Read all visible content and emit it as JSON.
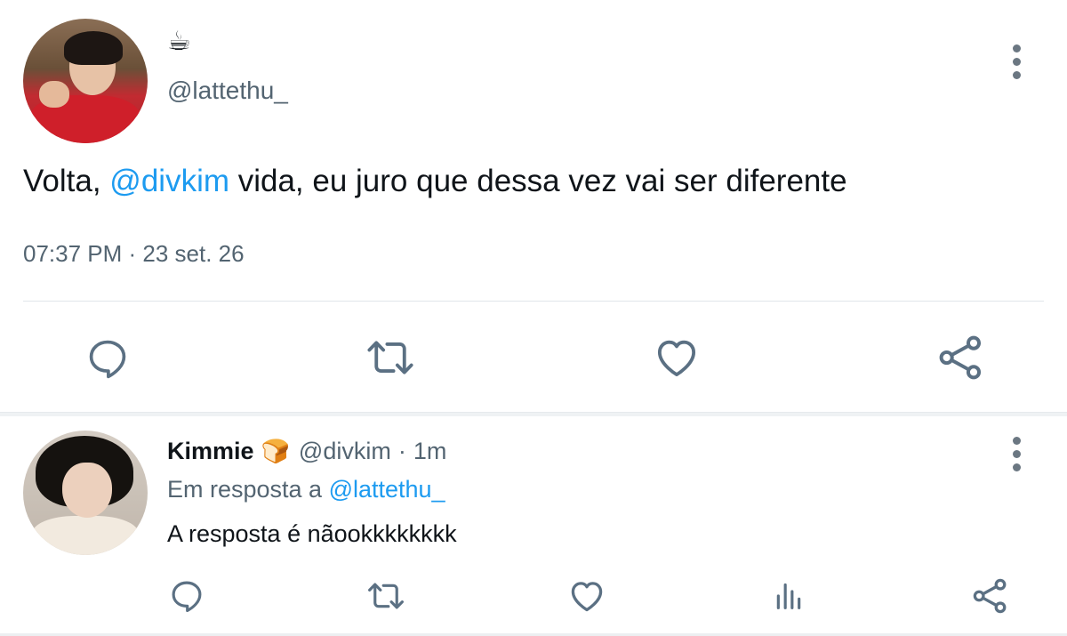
{
  "main_tweet": {
    "display_name_emoji": "☕",
    "handle": "@lattethu_",
    "text_before": "Volta, ",
    "mention": "@divkim",
    "text_after": " vida, eu juro que dessa vez vai ser diferente",
    "timestamp": "07:37 PM · 23 set. 26",
    "actions": [
      "reply-icon",
      "retweet-icon",
      "like-icon",
      "share-icon"
    ]
  },
  "reply": {
    "name": "Kimmie",
    "name_emoji": "🍞",
    "handle": "@divkim",
    "separator": "·",
    "time": "1m",
    "replying_to_label": "Em resposta a ",
    "replying_to_handle": "@lattethu_",
    "text": "A resposta é nãookkkkkkkk",
    "actions": [
      "reply-icon",
      "retweet-icon",
      "like-icon",
      "analytics-icon",
      "share-icon"
    ]
  },
  "colors": {
    "accent": "#1d9bf0",
    "secondary_text": "#536471",
    "primary_text": "#0f1419",
    "icon": "#5b7083"
  }
}
